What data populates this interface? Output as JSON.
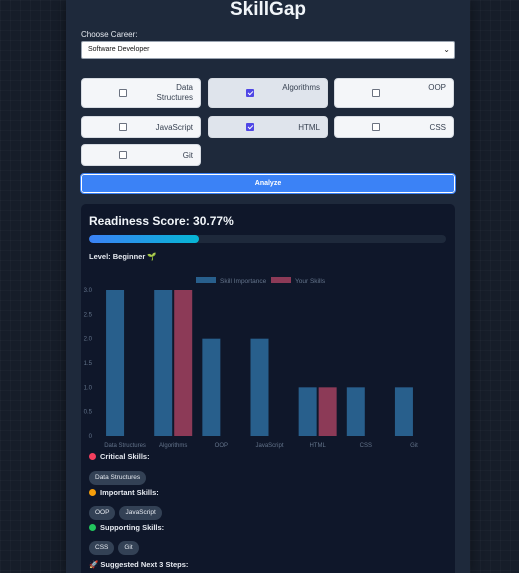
{
  "app": {
    "title": "SkillGap"
  },
  "career": {
    "label": "Choose Career:",
    "selected": "Software Developer"
  },
  "skills": [
    {
      "label": "Data Structures",
      "checked": false
    },
    {
      "label": "Algorithms",
      "checked": true
    },
    {
      "label": "OOP",
      "checked": false
    },
    {
      "label": "JavaScript",
      "checked": false
    },
    {
      "label": "HTML",
      "checked": true
    },
    {
      "label": "CSS",
      "checked": false
    },
    {
      "label": "Git",
      "checked": false
    }
  ],
  "analyze_label": "Analyze",
  "results": {
    "score_title": "Readiness Score: 30.77%",
    "score_percent": 30.77,
    "level": "Level: Beginner 🌱",
    "critical": {
      "title": "Critical Skills:",
      "color": "#f43f5e",
      "items": [
        "Data Structures"
      ]
    },
    "important": {
      "title": "Important Skills:",
      "color": "#f59e0b",
      "items": [
        "OOP",
        "JavaScript"
      ]
    },
    "supporting": {
      "title": "Supporting Skills:",
      "color": "#22c55e",
      "items": [
        "CSS",
        "Git"
      ]
    },
    "next_steps_title": "🚀 Suggested Next 3 Steps:"
  },
  "chart_data": {
    "type": "bar",
    "categories": [
      "Data Structures",
      "Algorithms",
      "OOP",
      "JavaScript",
      "HTML",
      "CSS",
      "Git"
    ],
    "series": [
      {
        "name": "Skill Importance",
        "values": [
          3,
          3,
          2,
          2,
          1,
          1,
          1
        ],
        "color": "#285f8c"
      },
      {
        "name": "Your Skills",
        "values": [
          0,
          3,
          0,
          0,
          1,
          0,
          0
        ],
        "color": "#8c3a57"
      }
    ],
    "ylim": [
      0,
      3
    ],
    "yticks": [
      "0",
      "0.5",
      "1.0",
      "1.5",
      "2.0",
      "2.5",
      "3.0"
    ],
    "legend": "top",
    "grid": false
  }
}
